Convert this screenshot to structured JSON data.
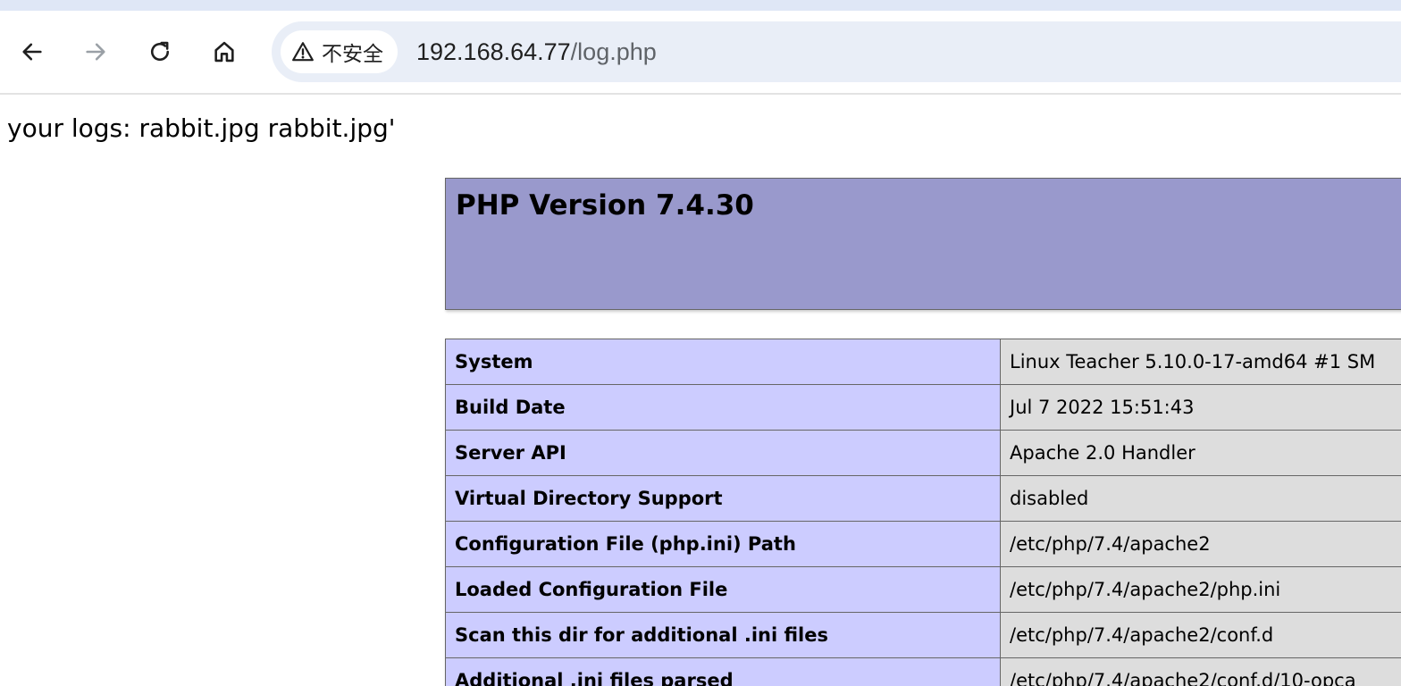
{
  "browser": {
    "security_label": "不安全",
    "url_host": "192.168.64.77",
    "url_path": "/log.php",
    "icons": {
      "back": "arrow-left-icon",
      "forward": "arrow-right-icon",
      "reload": "reload-icon",
      "home": "home-icon",
      "security": "warning-triangle-icon"
    }
  },
  "page": {
    "log_text": "your logs: rabbit.jpg rabbit.jpg'",
    "php_title": "PHP Version 7.4.30",
    "colors": {
      "header_bg": "#9999cc",
      "label_bg": "#ccccff",
      "value_bg": "#dddddd",
      "border": "#666666"
    },
    "info_rows": [
      {
        "label": "System",
        "value": "Linux Teacher 5.10.0-17-amd64 #1 SM"
      },
      {
        "label": "Build Date",
        "value": "Jul 7 2022 15:51:43"
      },
      {
        "label": "Server API",
        "value": "Apache 2.0 Handler"
      },
      {
        "label": "Virtual Directory Support",
        "value": "disabled"
      },
      {
        "label": "Configuration File (php.ini) Path",
        "value": "/etc/php/7.4/apache2"
      },
      {
        "label": "Loaded Configuration File",
        "value": "/etc/php/7.4/apache2/php.ini"
      },
      {
        "label": "Scan this dir for additional .ini files",
        "value": "/etc/php/7.4/apache2/conf.d"
      },
      {
        "label": "Additional .ini files parsed",
        "value": "/etc/php/7.4/apache2/conf.d/10-opca"
      }
    ]
  }
}
